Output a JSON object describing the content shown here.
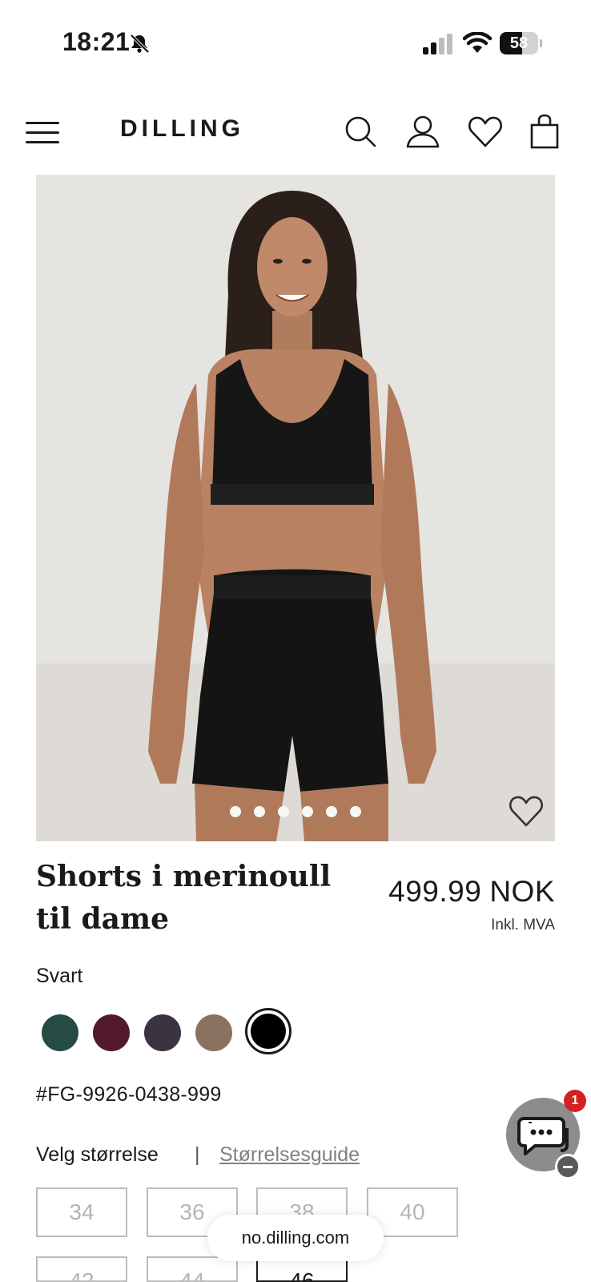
{
  "status_bar": {
    "time": "18:21",
    "battery_percent": "58",
    "battery_level": 0.58
  },
  "header": {
    "logo": "DILLING",
    "icons": [
      "menu-icon",
      "search-icon",
      "account-icon",
      "heart-icon",
      "bag-icon"
    ]
  },
  "gallery": {
    "dot_count": 6,
    "active_index": 0,
    "icons": [
      "wishlist-heart-icon"
    ]
  },
  "product": {
    "title": "Shorts i merinoull til dame",
    "price_value": "499.99",
    "price_currency": "NOK",
    "vat_note": "Inkl. MVA",
    "color_name": "Svart",
    "swatches": [
      {
        "color": "#264b45"
      },
      {
        "color": "#521a2a"
      },
      {
        "color": "#3b3340"
      },
      {
        "color": "#8a7261"
      },
      {
        "color": "#000000",
        "selected": true
      }
    ],
    "sku": "#FG-9926-0438-999"
  },
  "sizes": {
    "label": "Velg størrelse",
    "separator": "|",
    "guide_link": "Størrelsesguide",
    "options": [
      {
        "label": "34",
        "available": false
      },
      {
        "label": "36",
        "available": false
      },
      {
        "label": "38",
        "available": false
      },
      {
        "label": "40",
        "available": false
      },
      {
        "label": "42",
        "available": false
      },
      {
        "label": "44",
        "available": false
      },
      {
        "label": "46",
        "available": true
      }
    ]
  },
  "chat": {
    "badge_count": "1",
    "icons": [
      "chat-icon",
      "minimize-icon"
    ]
  },
  "browser": {
    "url": "no.dilling.com"
  }
}
